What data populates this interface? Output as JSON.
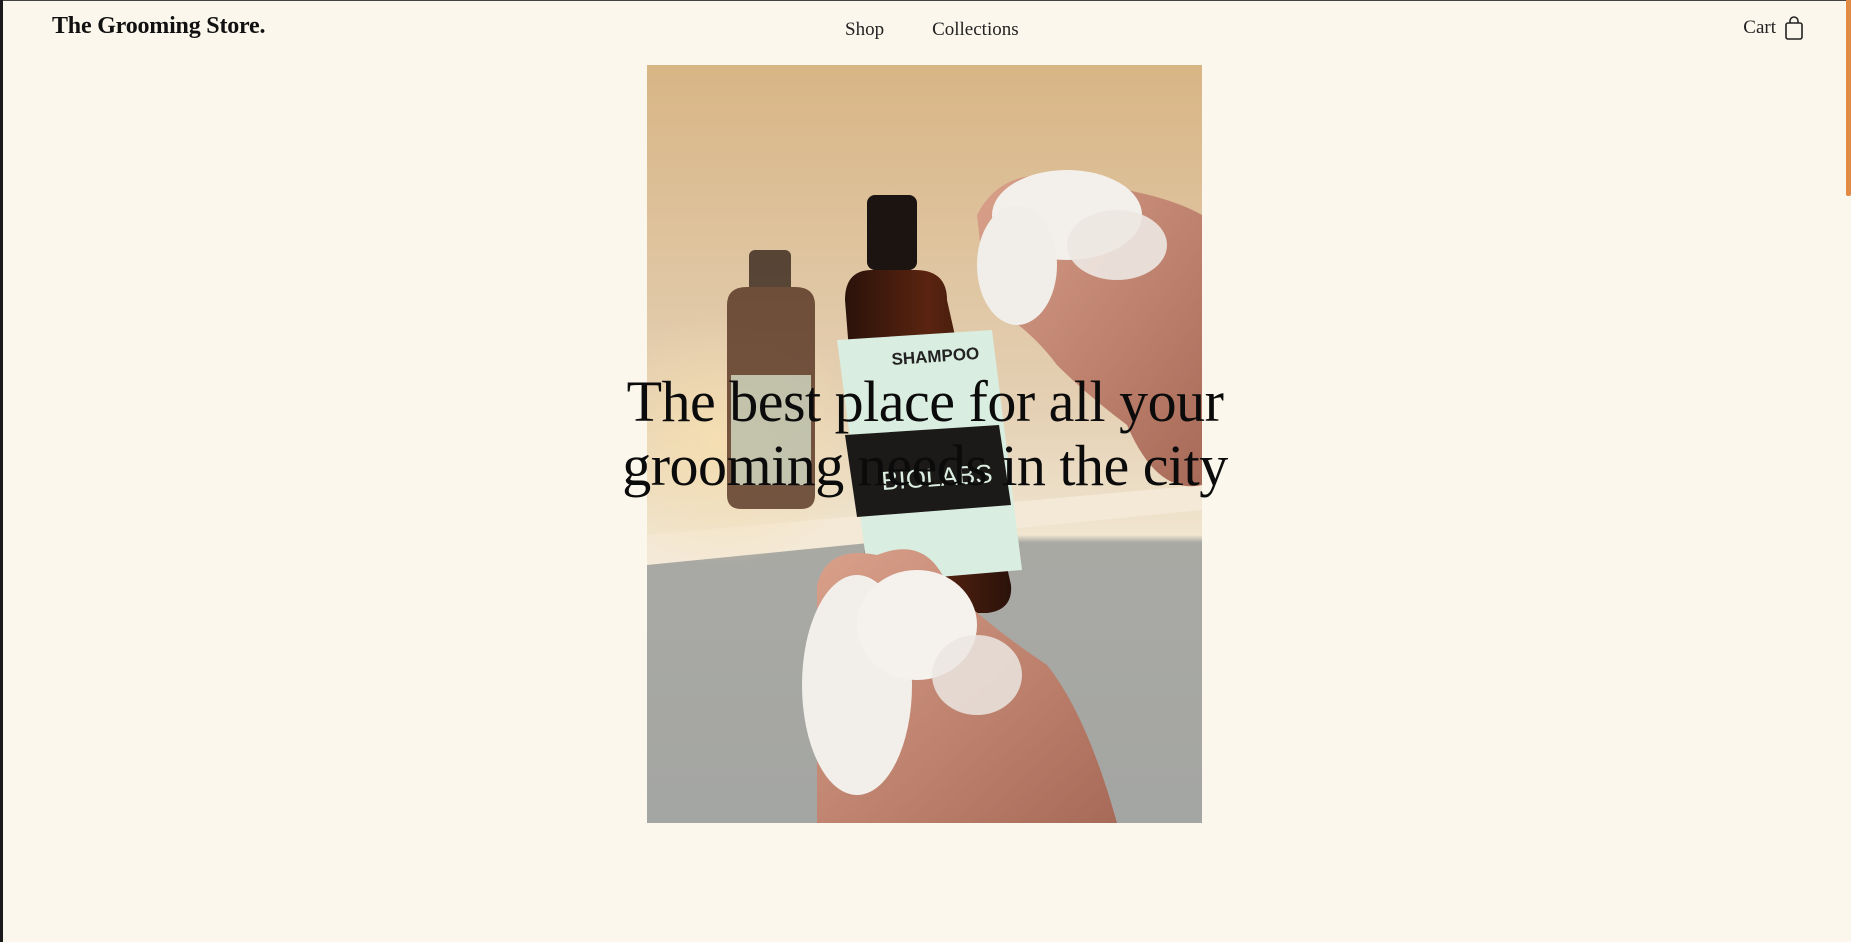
{
  "header": {
    "logo": "The Grooming Store.",
    "nav": [
      "Shop",
      "Collections"
    ],
    "cart_label": "Cart",
    "cart_icon": "shopping-bag-icon"
  },
  "hero": {
    "title": "The best place for all your grooming needs in the city",
    "image_subject": "hands-with-foam-holding-shampoo-bottle"
  },
  "colors": {
    "background": "#fbf7ec",
    "accent_scrollbar": "#e08a44",
    "text": "#111111"
  }
}
